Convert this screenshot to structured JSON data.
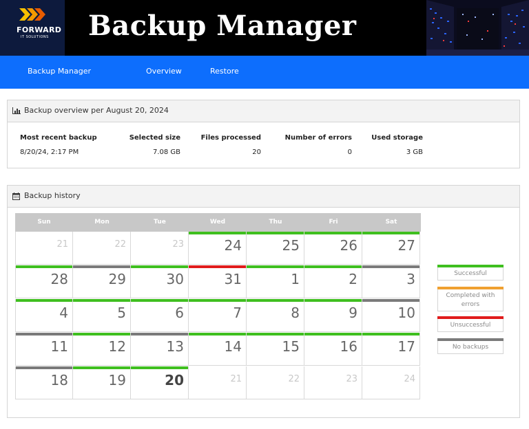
{
  "colors": {
    "nav": "#0d6efd",
    "successful": "#3fbf1f",
    "completed_with_errors": "#f0a030",
    "unsuccessful": "#e01b1b",
    "no_backups": "#7a7a7a"
  },
  "header": {
    "logo_text": "FORWARD",
    "logo_subtext": "IT SOLUTIONS",
    "title": "Backup Manager"
  },
  "nav": {
    "items": [
      {
        "label": "Backup Manager"
      },
      {
        "label": "Overview"
      },
      {
        "label": "Restore"
      }
    ]
  },
  "overview": {
    "icon": "bar-chart-icon",
    "title": "Backup overview per August 20, 2024",
    "stats": [
      {
        "label": "Most recent backup",
        "value": "8/20/24, 2:17 PM"
      },
      {
        "label": "Selected size",
        "value": "7.08 GB"
      },
      {
        "label": "Files processed",
        "value": "20"
      },
      {
        "label": "Number of errors",
        "value": "0"
      },
      {
        "label": "Used storage",
        "value": "3 GB"
      }
    ]
  },
  "history": {
    "icon": "calendar-icon",
    "title": "Backup history",
    "weekdays": [
      "Sun",
      "Mon",
      "Tue",
      "Wed",
      "Thu",
      "Fri",
      "Sat"
    ],
    "weeks": [
      [
        {
          "day": "21",
          "muted": true,
          "status": "none"
        },
        {
          "day": "22",
          "muted": true,
          "status": "none"
        },
        {
          "day": "23",
          "muted": true,
          "status": "none"
        },
        {
          "day": "24",
          "muted": false,
          "status": "successful"
        },
        {
          "day": "25",
          "muted": false,
          "status": "successful"
        },
        {
          "day": "26",
          "muted": false,
          "status": "successful"
        },
        {
          "day": "27",
          "muted": false,
          "status": "successful"
        }
      ],
      [
        {
          "day": "28",
          "muted": false,
          "status": "successful"
        },
        {
          "day": "29",
          "muted": false,
          "status": "no_backups"
        },
        {
          "day": "30",
          "muted": false,
          "status": "successful"
        },
        {
          "day": "31",
          "muted": false,
          "status": "unsuccessful"
        },
        {
          "day": "1",
          "muted": false,
          "status": "successful"
        },
        {
          "day": "2",
          "muted": false,
          "status": "successful"
        },
        {
          "day": "3",
          "muted": false,
          "status": "no_backups"
        }
      ],
      [
        {
          "day": "4",
          "muted": false,
          "status": "successful"
        },
        {
          "day": "5",
          "muted": false,
          "status": "successful"
        },
        {
          "day": "6",
          "muted": false,
          "status": "successful"
        },
        {
          "day": "7",
          "muted": false,
          "status": "successful"
        },
        {
          "day": "8",
          "muted": false,
          "status": "successful"
        },
        {
          "day": "9",
          "muted": false,
          "status": "successful"
        },
        {
          "day": "10",
          "muted": false,
          "status": "no_backups"
        }
      ],
      [
        {
          "day": "11",
          "muted": false,
          "status": "no_backups"
        },
        {
          "day": "12",
          "muted": false,
          "status": "successful"
        },
        {
          "day": "13",
          "muted": false,
          "status": "no_backups"
        },
        {
          "day": "14",
          "muted": false,
          "status": "successful"
        },
        {
          "day": "15",
          "muted": false,
          "status": "successful"
        },
        {
          "day": "16",
          "muted": false,
          "status": "successful"
        },
        {
          "day": "17",
          "muted": false,
          "status": "successful"
        }
      ],
      [
        {
          "day": "18",
          "muted": false,
          "status": "no_backups"
        },
        {
          "day": "19",
          "muted": false,
          "status": "successful"
        },
        {
          "day": "20",
          "muted": false,
          "status": "successful",
          "today": true
        },
        {
          "day": "21",
          "muted": true,
          "status": "none"
        },
        {
          "day": "22",
          "muted": true,
          "status": "none"
        },
        {
          "day": "23",
          "muted": true,
          "status": "none"
        },
        {
          "day": "24",
          "muted": true,
          "status": "none"
        }
      ]
    ],
    "legend": [
      {
        "key": "successful",
        "label": "Successful"
      },
      {
        "key": "completed_with_errors",
        "label": "Completed with errors"
      },
      {
        "key": "unsuccessful",
        "label": "Unsuccessful"
      },
      {
        "key": "no_backups",
        "label": "No backups"
      }
    ]
  }
}
